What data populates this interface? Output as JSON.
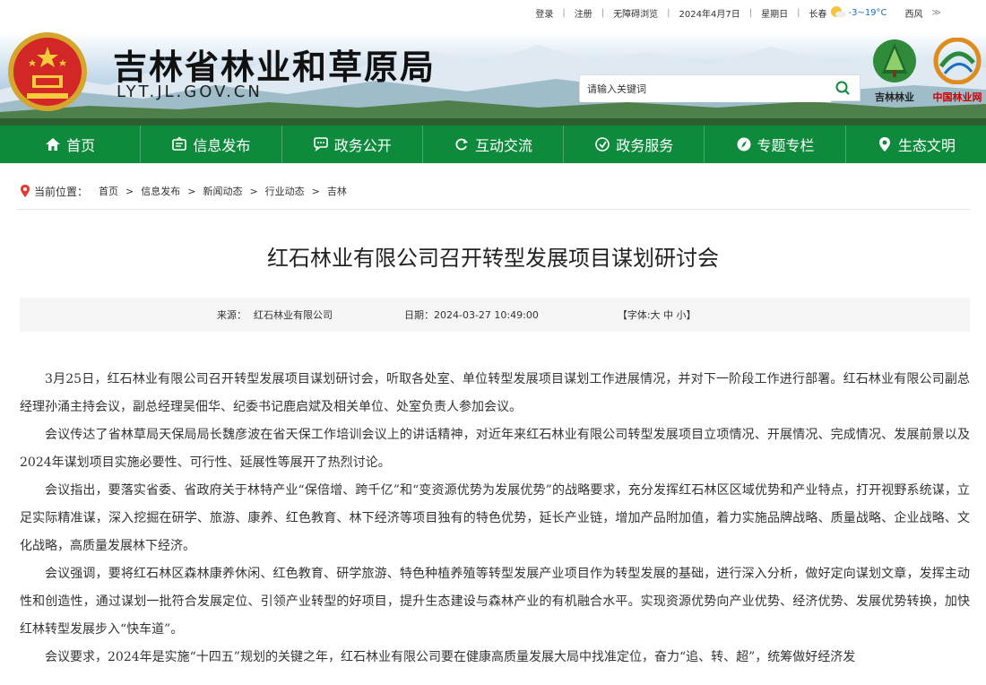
{
  "topbar": {
    "login": "登录",
    "register": "注册",
    "accessible": "无障碍浏览",
    "date": "2024年4月7日",
    "weekday": "星期日",
    "city": "长春",
    "temp": "-3~19°C",
    "wind": "西风",
    "more": "≫"
  },
  "header": {
    "title": "吉林省林业和草原局",
    "url": "LYT.JL.GOV.CN",
    "search_placeholder": "请输入关键词",
    "logo1_label": "吉林林业",
    "logo2_label": "中国林业网"
  },
  "nav": [
    {
      "label": "首页",
      "icon": "home-icon"
    },
    {
      "label": "信息发布",
      "icon": "info-icon"
    },
    {
      "label": "政务公开",
      "icon": "chat-icon"
    },
    {
      "label": "互动交流",
      "icon": "refresh-icon"
    },
    {
      "label": "政务服务",
      "icon": "service-icon"
    },
    {
      "label": "专题专栏",
      "icon": "compass-icon"
    },
    {
      "label": "生态文明",
      "icon": "location-icon"
    }
  ],
  "breadcrumb": {
    "label": "当前位置：",
    "items": [
      "首页",
      "信息发布",
      "新闻动态",
      "行业动态",
      "吉林"
    ],
    "sep": ">"
  },
  "article": {
    "title": "红石林业有限公司召开转型发展项目谋划研讨会",
    "source_label": "来源：",
    "source": "红石林业有限公司",
    "date_label": "日期：",
    "date": "2024-03-27 10:49:00",
    "font_label": "【字体:大 中 小】",
    "paragraphs": [
      "3月25日，红石林业有限公司召开转型发展项目谋划研讨会，听取各处室、单位转型发展项目谋划工作进展情况，并对下一阶段工作进行部署。红石林业有限公司副总经理孙涌主持会议，副总经理吴佃华、纪委书记鹿启斌及相关单位、处室负责人参加会议。",
      "会议传达了省林草局天保局局长魏彦波在省天保工作培训会议上的讲话精神，对近年来红石林业有限公司转型发展项目立项情况、开展情况、完成情况、发展前景以及2024年谋划项目实施必要性、可行性、延展性等展开了热烈讨论。",
      "会议指出，要落实省委、省政府关于林特产业“保倍增、跨千亿”和“变资源优势为发展优势”的战略要求，充分发挥红石林区区域优势和产业特点，打开视野系统谋，立足实际精准谋，深入挖掘在研学、旅游、康养、红色教育、林下经济等项目独有的特色优势，延长产业链，增加产品附加值，着力实施品牌战略、质量战略、企业战略、文化战略，高质量发展林下经济。",
      "会议强调，要将红石林区森林康养休闲、红色教育、研学旅游、特色种植养殖等转型发展产业项目作为转型发展的基础，进行深入分析，做好定向谋划文章，发挥主动性和创造性，通过谋划一批符合发展定位、引领产业转型的好项目，提升生态建设与森林产业的有机融合水平。实现资源优势向产业优势、经济优势、发展优势转换，加快红林转型发展步入“快车道”。",
      "会议要求，2024年是实施“十四五”规划的关键之年，红石林业有限公司要在健康高质量发展大局中找准定位，奋力“追、转、超”，统筹做好经济发"
    ]
  }
}
